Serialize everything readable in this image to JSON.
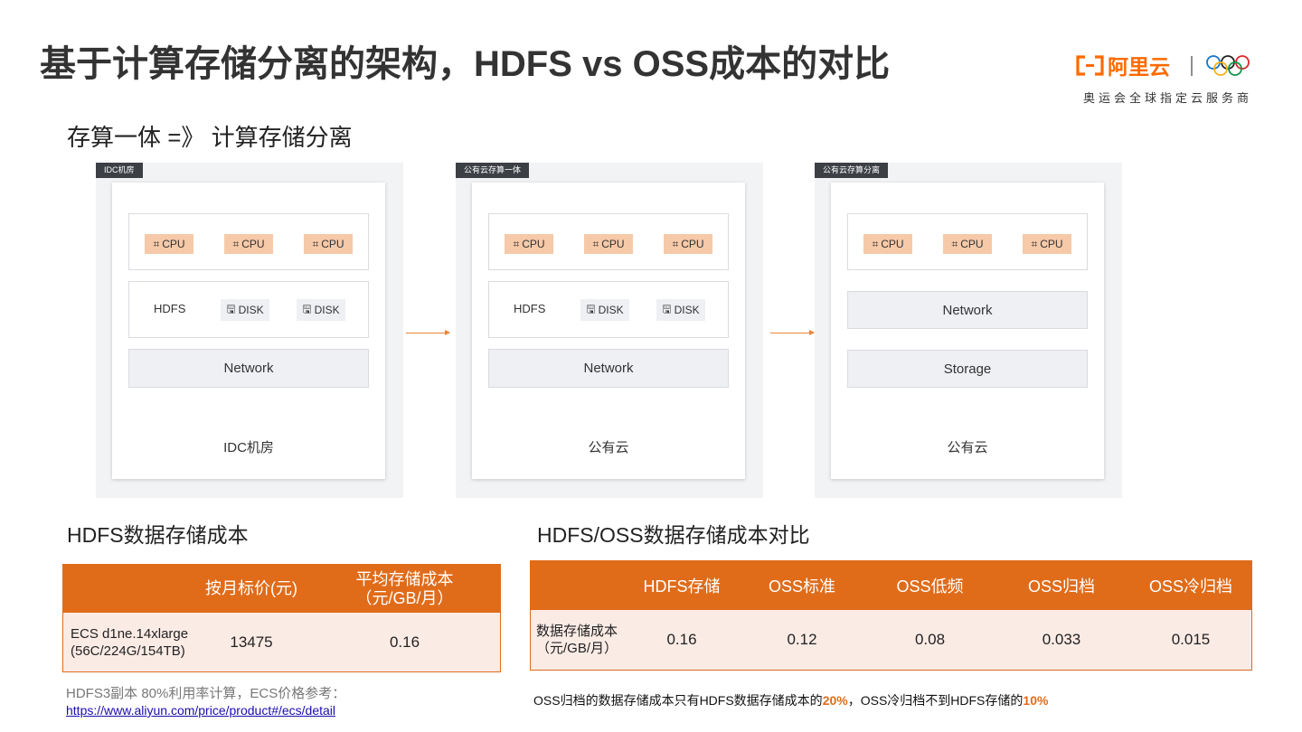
{
  "title": "基于计算存储分离的架构，HDFS vs OSS成本的对比",
  "logo": {
    "brand": "阿里云",
    "tagline": "奥运会全球指定云服务商"
  },
  "subtitle": "存算一体 =》 计算存储分离",
  "panels": [
    {
      "tag": "IDC机房",
      "cpus": [
        "CPU",
        "CPU",
        "CPU"
      ],
      "hdfs_label": "HDFS",
      "disks": [
        "DISK",
        "DISK"
      ],
      "network": "Network",
      "label": "IDC机房"
    },
    {
      "tag": "公有云存算一体",
      "cpus": [
        "CPU",
        "CPU",
        "CPU"
      ],
      "hdfs_label": "HDFS",
      "disks": [
        "DISK",
        "DISK"
      ],
      "network": "Network",
      "label": "公有云"
    },
    {
      "tag": "公有云存算分离",
      "cpus": [
        "CPU",
        "CPU",
        "CPU"
      ],
      "network": "Network",
      "storage": "Storage",
      "label": "公有云"
    }
  ],
  "hdfs_cost": {
    "title": "HDFS数据存储成本",
    "headers": [
      "",
      "按月标价(元)",
      "平均存储成本",
      "（元/GB/月）"
    ],
    "row": {
      "instance": "ECS d1ne.14xlarge",
      "spec": "(56C/224G/154TB)",
      "price": "13475",
      "avg": "0.16"
    }
  },
  "compare": {
    "title": "HDFS/OSS数据存储成本对比",
    "headers": [
      "",
      "HDFS存储",
      "OSS标准",
      "OSS低频",
      "OSS归档",
      "OSS冷归档"
    ],
    "row_label_1": "数据存储成本",
    "row_label_2": "（元/GB/月）",
    "values": [
      "0.16",
      "0.12",
      "0.08",
      "0.033",
      "0.015"
    ]
  },
  "note": {
    "text": "HDFS3副本 80%利用率计算，ECS价格参考：",
    "link": "https://www.aliyun.com/price/product#/ecs/detail"
  },
  "summary": {
    "part1": "OSS归档的数据存储成本只有HDFS数据存储成本的",
    "pct1": "20%",
    "part2": "，OSS冷归档不到HDFS存储的",
    "pct2": "10%"
  },
  "colors": {
    "accent": "#e06c1a",
    "cpu_chip": "#f6c9a8",
    "row_bg": "#fbebe5"
  }
}
